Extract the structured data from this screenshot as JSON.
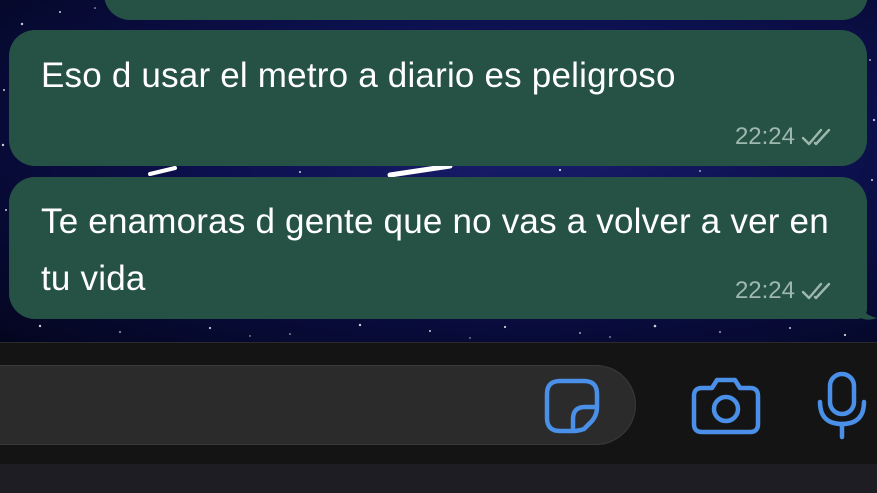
{
  "messages": [
    {
      "text": "Eso d usar el metro a diario es peligroso",
      "time": "22:24",
      "status": "read"
    },
    {
      "text": "Te enamoras d gente que no vas a volver a ver en tu vida",
      "time": "22:24",
      "status": "read"
    }
  ],
  "composer": {
    "message_value": "",
    "icons": [
      "sticker-icon",
      "camera-icon",
      "microphone-icon"
    ]
  },
  "colors": {
    "bubble_outgoing": "#265245",
    "timestamp": "#9fb8ae",
    "accent_icon": "#4a8fe8",
    "composer_bg": "#141414",
    "input_bg": "#2b2b2b"
  }
}
